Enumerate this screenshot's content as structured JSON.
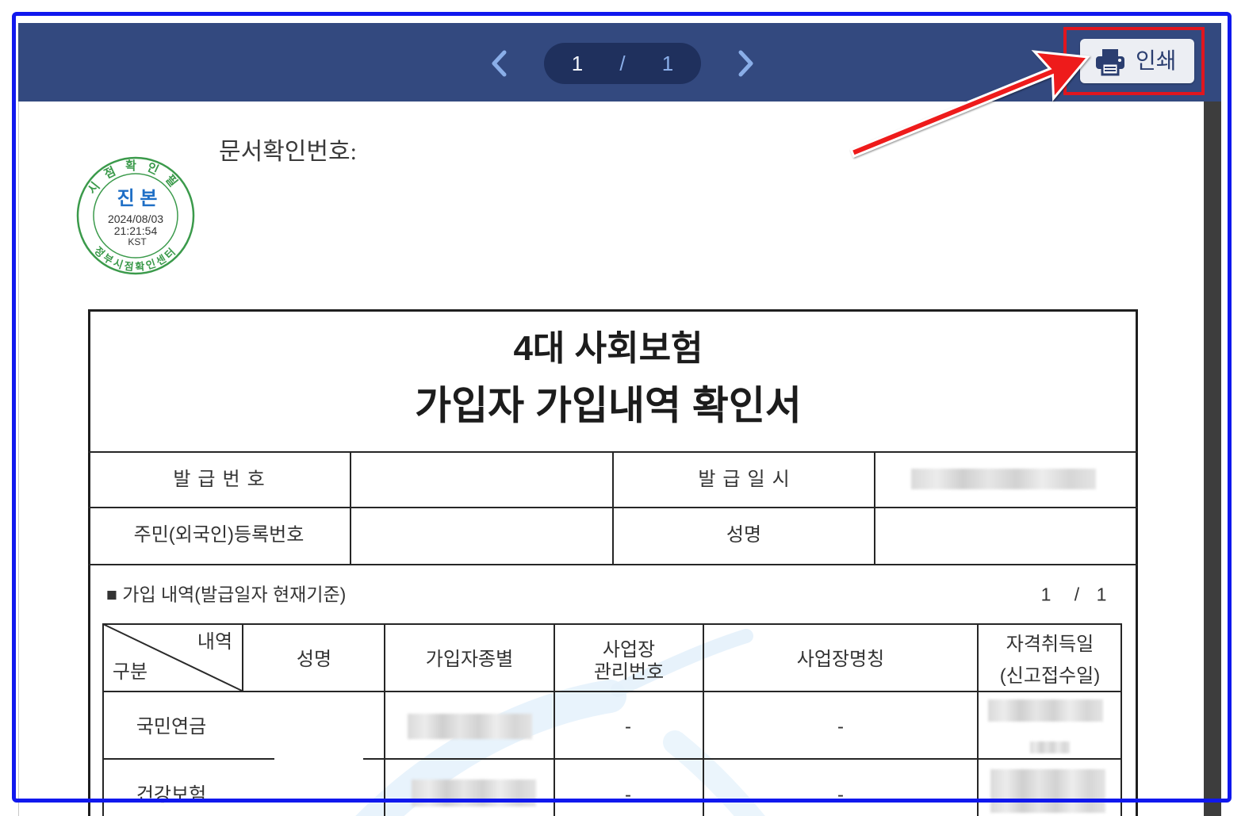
{
  "theme": {
    "toolbar_bg": "#33497f",
    "page_pill_bg": "#1f305d",
    "nav_accent": "#8aaee8",
    "print_button_bg": "#eceef3",
    "print_button_fg": "#2b3e70",
    "scrollbar_bg": "#3d3d3d",
    "frame_color": "#1018ee",
    "highlight_color": "#e0161f",
    "arrow_color": "#ee1b1b",
    "seal_green": "#3b9a4b",
    "seal_blue": "#1f6fc6",
    "watermark": "#e4f1fb"
  },
  "viewer": {
    "toolbar": {
      "prev_icon": "chevron-left-icon",
      "current_page": "1",
      "page_separator": "/",
      "total_pages": "1",
      "next_icon": "chevron-right-icon",
      "print_icon": "printer-icon",
      "print_label": "인쇄"
    }
  },
  "document": {
    "confirmation_number_label": "문서확인번호:",
    "seal": {
      "top_text": "시점확인필",
      "center_text": "진 본",
      "date": "2024/08/03",
      "time": "21:21:54",
      "timezone": "KST",
      "bottom_text": "정부시점확인센터"
    },
    "title": {
      "line1": "4대 사회보험",
      "line2": "가입자 가입내역 확인서"
    },
    "info": {
      "issue_number_label": "발급번호",
      "issue_datetime_label": "발급일시",
      "registration_number_label": "주민(외국인)등록번호",
      "name_label": "성명"
    },
    "enrollment": {
      "section_title": "■ 가입 내역(발급일자 현재기준)",
      "page_current": "1",
      "page_separator": "/",
      "page_total": "1",
      "headers": {
        "corner_top": "내역",
        "corner_bottom": "구분",
        "name": "성명",
        "member_type": "가입자종별",
        "workplace_id_line1": "사업장",
        "workplace_id_line2": "관리번호",
        "workplace_name": "사업장명칭",
        "acquisition_date_line1": "자격취득일",
        "acquisition_date_line2": "(신고접수일)"
      },
      "rows": [
        {
          "category": "국민연금",
          "workplace_id": "-",
          "workplace_name": "-"
        },
        {
          "category": "건강보험",
          "workplace_id": "-",
          "workplace_name": "-"
        }
      ]
    }
  }
}
